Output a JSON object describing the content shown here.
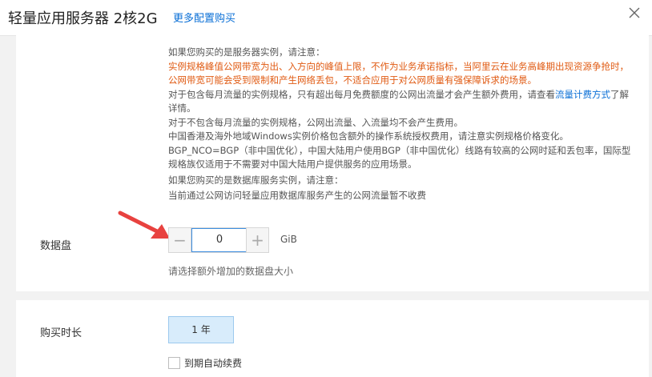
{
  "header": {
    "title": "轻量应用服务器 2核2G",
    "more_config": "更多配置购买",
    "close_icon": "close-icon"
  },
  "notes": {
    "server_title": "如果您购买的是服务器实例，请注意：",
    "warning": "实例规格峰值公网带宽为出、入方向的峰值上限，不作为业务承诺指标，当阿里云在业务高峰期出现资源争抢时，公网带宽可能会受到限制和产生网络丢包，不适合应用于对公网质量有强保障诉求的场景。",
    "traffic_before": "对于包含每月流量的实例规格，只有超出每月免费额度的公网出流量才会产生额外费用，请查看",
    "traffic_link": "流量计费方式",
    "traffic_after": "了解详情。",
    "no_traffic": "对于不包含每月流量的实例规格，公网出流量、入流量均不会产生费用。",
    "windows": "中国香港及海外地域Windows实例价格包含额外的操作系统授权费用，请注意实例规格价格变化。",
    "bgp": "BGP_NCO=BGP（非中国优化），中国大陆用户使用BGP（非中国优化）线路有较高的公网时延和丢包率，国际型规格族仅适用于不需要对中国大陆用户提供服务的应用场景。",
    "db_title": "如果您购买的是数据库服务实例，请注意：",
    "db_note": "当前通过公网访问轻量应用数据库服务产生的公网流量暂不收费"
  },
  "data_disk": {
    "label": "数据盘",
    "value": "0",
    "minus": "−",
    "plus": "+",
    "unit": "GiB",
    "hint": "请选择额外增加的数据盘大小"
  },
  "duration": {
    "label": "购买时长",
    "option": "1 年",
    "auto_renew": "到期自动续费",
    "auto_renew_checked": false
  },
  "colors": {
    "link": "#0a6fd6",
    "warning": "#e05a12",
    "arrow": "#e8423f",
    "selected_bg": "#d8ecfb"
  }
}
